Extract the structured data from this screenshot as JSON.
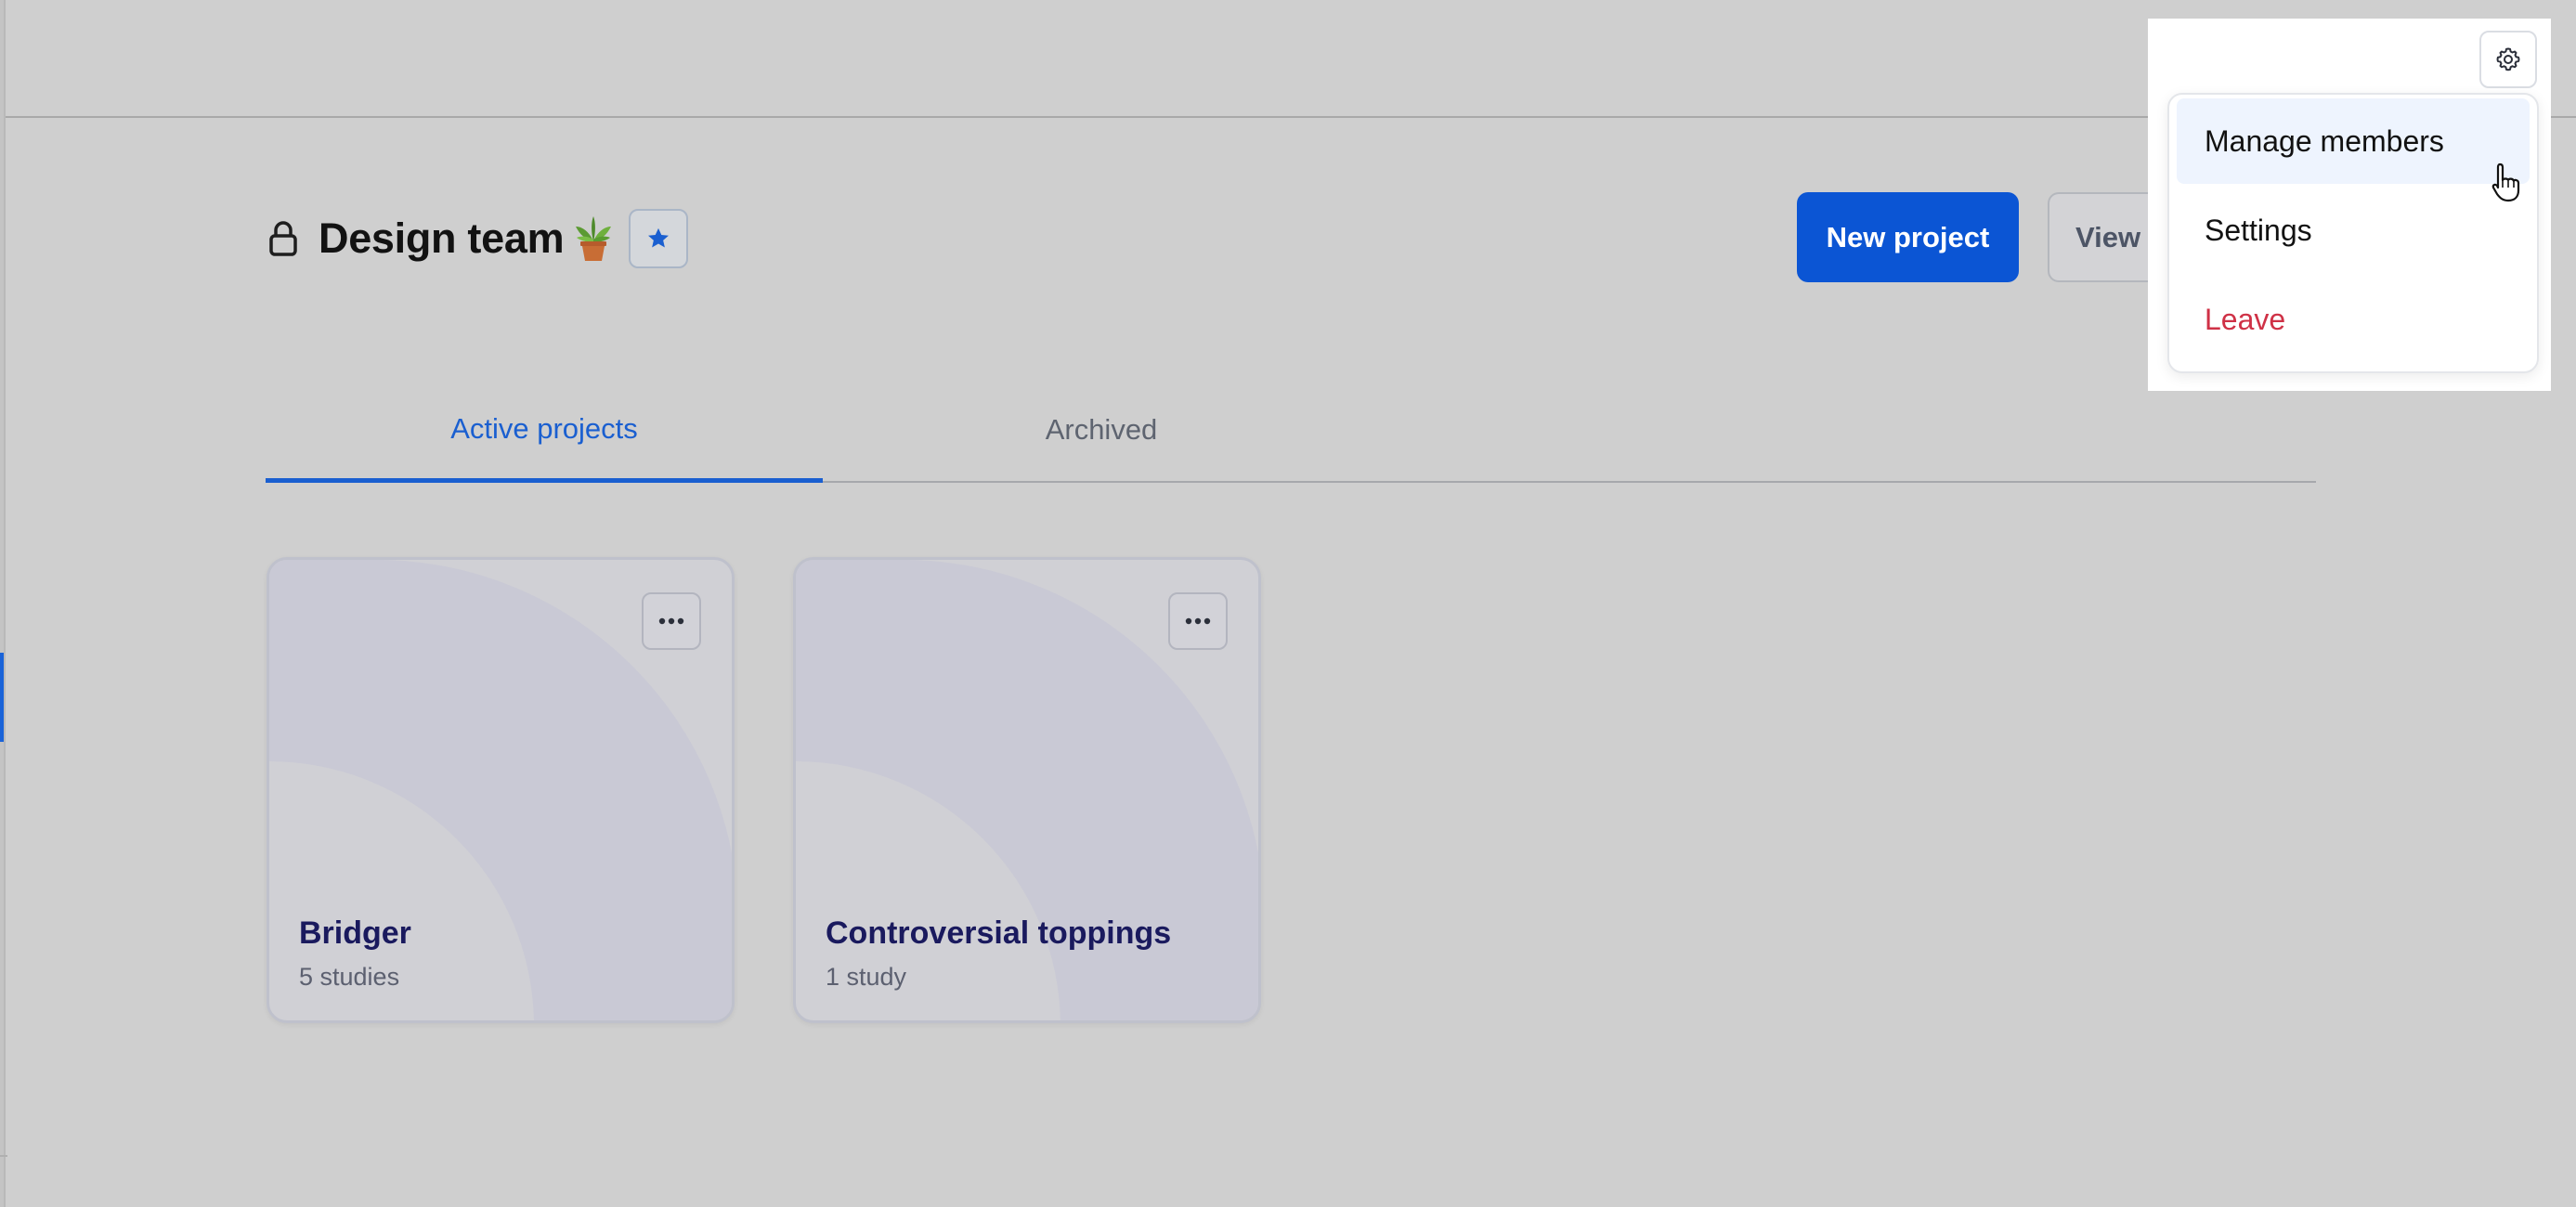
{
  "team": {
    "title": "Design team",
    "favorited": true
  },
  "actions": {
    "new_project": "New project",
    "view_team": "View Team"
  },
  "tabs": [
    {
      "label": "Active projects",
      "active": true
    },
    {
      "label": "Archived",
      "active": false
    }
  ],
  "projects": [
    {
      "title": "Bridger",
      "subtitle": "5 studies"
    },
    {
      "title": "Controversial toppings",
      "subtitle": "1 study"
    }
  ],
  "menu": {
    "items": [
      {
        "label": "Manage members",
        "hovered": true
      },
      {
        "label": "Settings"
      },
      {
        "label": "Leave",
        "danger": true
      }
    ]
  },
  "colors": {
    "accent": "#0b55d4",
    "danger": "#cf3146",
    "card_title": "#1a1a5e"
  },
  "icons": [
    "lock-icon",
    "plant-emoji-icon",
    "star-icon",
    "more-horizontal-icon",
    "gear-icon",
    "pointer-cursor-icon"
  ]
}
